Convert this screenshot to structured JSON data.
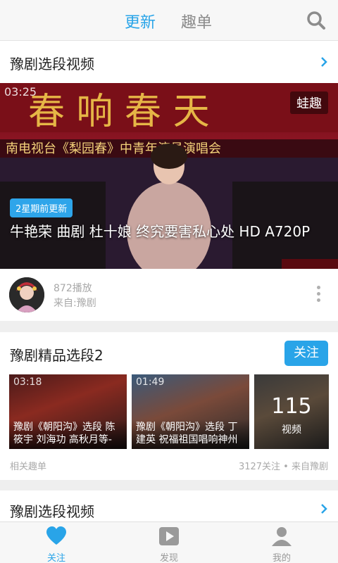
{
  "header": {
    "tabs": [
      {
        "label": "更新",
        "active": true
      },
      {
        "label": "趣单",
        "active": false
      }
    ],
    "search_icon": "search-icon"
  },
  "section1": {
    "title": "豫剧选段视频",
    "video": {
      "duration": "03:25",
      "badge": "蛙趣",
      "update_tag": "2星期前更新",
      "title": "牛艳荣 曲剧 杜十娘 终究要害私心处 HD A720P"
    },
    "meta": {
      "plays": "872播放",
      "source": "来自:豫剧"
    }
  },
  "section2": {
    "title": "豫剧精品选段2",
    "follow_label": "关注",
    "thumbs": [
      {
        "duration": "03:18",
        "caption": "豫剧《朝阳沟》选段 陈筱宇 刘海功 高秋月等-"
      },
      {
        "duration": "01:49",
        "caption": "豫剧《朝阳沟》选段 丁建英 祝福祖国唱响神州"
      }
    ],
    "more": {
      "count": "115",
      "unit": "视频"
    },
    "footer_left": "相关趣单",
    "footer_right": "3127关注 • 来自豫剧"
  },
  "section3": {
    "title": "豫剧选段视频"
  },
  "bottom_nav": [
    {
      "label": "关注",
      "icon": "heart-icon",
      "active": true
    },
    {
      "label": "发现",
      "icon": "play-icon",
      "active": false
    },
    {
      "label": "我的",
      "icon": "user-icon",
      "active": false
    }
  ],
  "colors": {
    "accent": "#29a4e8",
    "text_primary": "#222222",
    "text_secondary": "#a8a8a8"
  }
}
